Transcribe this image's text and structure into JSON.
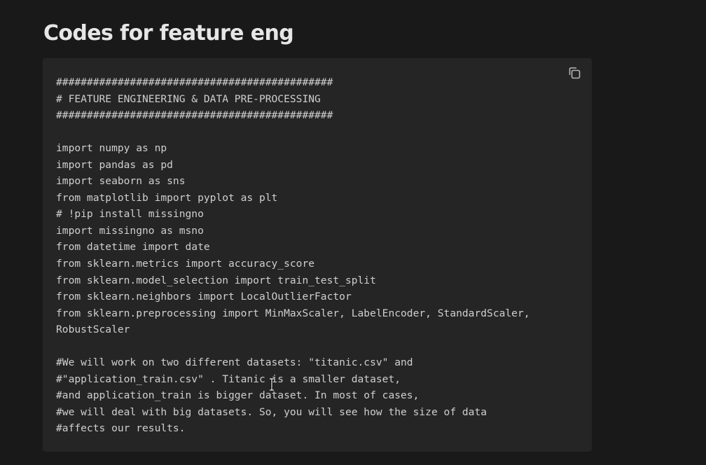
{
  "page": {
    "title": "Codes for feature eng"
  },
  "code_block": {
    "copy_icon": "copy-icon",
    "lines": [
      "#############################################",
      "# FEATURE ENGINEERING & DATA PRE-PROCESSING",
      "#############################################",
      "",
      "import numpy as np",
      "import pandas as pd",
      "import seaborn as sns",
      "from matplotlib import pyplot as plt",
      "# !pip install missingno",
      "import missingno as msno",
      "from datetime import date",
      "from sklearn.metrics import accuracy_score",
      "from sklearn.model_selection import train_test_split",
      "from sklearn.neighbors import LocalOutlierFactor",
      "from sklearn.preprocessing import MinMaxScaler, LabelEncoder, StandardScaler,",
      "RobustScaler",
      "",
      "#We will work on two different datasets: \"titanic.csv\" and",
      "#\"application_train.csv\" . Titanic is a smaller dataset,",
      "#and application_train is bigger dataset. In most of cases,",
      "#we will deal with big datasets. So, you will see how the size of data",
      "#affects our results."
    ]
  },
  "colors": {
    "background": "#191919",
    "code_background": "#252525",
    "text": "#cfcfcf",
    "title": "#e6e6e6"
  }
}
